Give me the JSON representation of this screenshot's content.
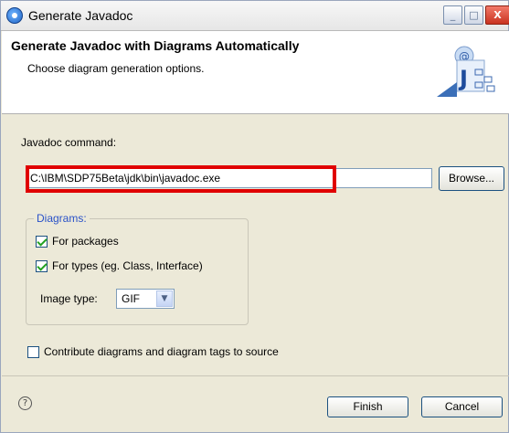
{
  "window": {
    "title": "Generate Javadoc",
    "min_glyph": "_",
    "max_glyph": "□",
    "close_glyph": "X"
  },
  "header": {
    "title": "Generate Javadoc with Diagrams Automatically",
    "subtitle": "Choose diagram generation options."
  },
  "javadoc": {
    "label": "Javadoc command:",
    "value": "C:\\IBM\\SDP75Beta\\jdk\\bin\\javadoc.exe",
    "browse_label": "Browse..."
  },
  "diagrams": {
    "legend": "Diagrams:",
    "for_packages": {
      "label": "For packages",
      "checked": true
    },
    "for_types": {
      "label": "For types (eg. Class, Interface)",
      "checked": true
    },
    "image_type_label": "Image type:",
    "image_type_value": "GIF"
  },
  "contribute": {
    "label": "Contribute diagrams and diagram tags to source",
    "checked": false
  },
  "footer": {
    "help_glyph": "?",
    "finish_label": "Finish",
    "cancel_label": "Cancel"
  },
  "colors": {
    "highlight": "#e00000",
    "legend": "#2a52c8",
    "check": "#21a121"
  }
}
